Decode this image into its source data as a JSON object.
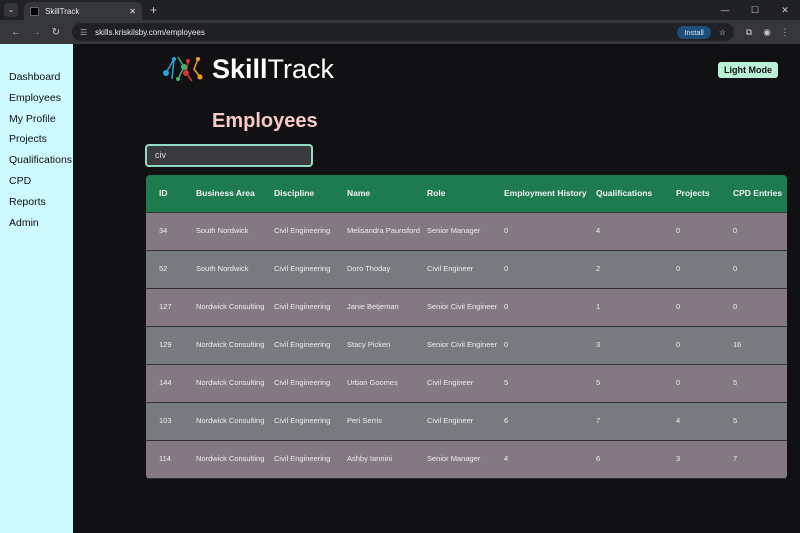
{
  "browser": {
    "tab_title": "SkillTrack",
    "url": "skills.kriskilsby.com/employees",
    "install_label": "Install"
  },
  "sidebar": {
    "items": [
      "Dashboard",
      "Employees",
      "My Profile",
      "Projects",
      "Qualifications",
      "CPD",
      "Reports",
      "Admin"
    ]
  },
  "header": {
    "logo_bold": "Skill",
    "logo_light": "Track",
    "theme_button": "Light Mode"
  },
  "page": {
    "title": "Employees",
    "search_value": "civ"
  },
  "table": {
    "headers": [
      "ID",
      "Business Area",
      "Discipline",
      "Name",
      "Role",
      "Employment History",
      "Qualifications",
      "Projects",
      "CPD Entries"
    ],
    "rows": [
      [
        "34",
        "South Nordwick",
        "Civil Engineering",
        "Melisandra Paunsford",
        "Senior Manager",
        "0",
        "4",
        "0",
        "0"
      ],
      [
        "52",
        "South Nordwick",
        "Civil Engineering",
        "Doro Thoday",
        "Civil Engineer",
        "0",
        "2",
        "0",
        "0"
      ],
      [
        "127",
        "Nordwick Consulting",
        "Civil Engineering",
        "Janie Betjeman",
        "Senior Civil Engineer",
        "0",
        "1",
        "0",
        "0"
      ],
      [
        "129",
        "Nordwick Consulting",
        "Civil Engineering",
        "Stacy Picken",
        "Senior Civil Engineer",
        "0",
        "3",
        "0",
        "16"
      ],
      [
        "144",
        "Nordwick Consulting",
        "Civil Engineering",
        "Urban Goomes",
        "Civil Engineer",
        "5",
        "5",
        "0",
        "5"
      ],
      [
        "103",
        "Nordwick Consulting",
        "Civil Engineering",
        "Peri Serris",
        "Civil Engineer",
        "6",
        "7",
        "4",
        "5"
      ],
      [
        "114",
        "Nordwick Consulting",
        "Civil Engineering",
        "Ashby Iannini",
        "Senior Manager",
        "4",
        "6",
        "3",
        "7"
      ]
    ]
  },
  "colors": {
    "header_green": "#1e7b4f",
    "sidebar": "#ccfaff",
    "title": "#f8c9c9"
  }
}
